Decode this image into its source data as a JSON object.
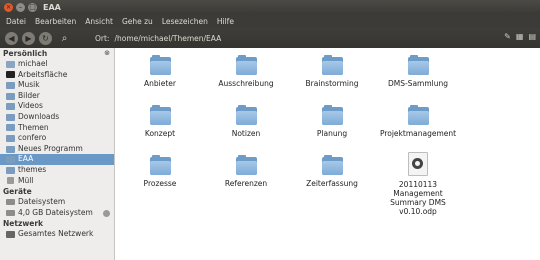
{
  "window": {
    "title": "EAA",
    "close_glyph": "×",
    "minimize_glyph": "–",
    "maximize_glyph": "□"
  },
  "menu": [
    "Datei",
    "Bearbeiten",
    "Ansicht",
    "Gehe zu",
    "Lesezeichen",
    "Hilfe"
  ],
  "toolbar": {
    "back_icon": "back-arrow-icon",
    "forward_icon": "forward-arrow-icon",
    "reload_icon": "reload-icon",
    "search_icon": "search-icon",
    "search_glyph": "⌕",
    "location_label": "Ort:",
    "location_path": "/home/michael/Themen/EAA",
    "view_icons": [
      "edit-path-icon",
      "icon-view-icon",
      "list-view-icon"
    ],
    "view_glyphs": [
      "✎",
      "▦",
      "▤"
    ]
  },
  "sidebar": {
    "personal_title": "Persönlich",
    "close_glyph": "⊗",
    "personal": [
      {
        "label": "michael",
        "icon": "home-icon"
      },
      {
        "label": "Arbeitsfläche",
        "icon": "desktop-icon"
      },
      {
        "label": "Musik",
        "icon": "folder-icon"
      },
      {
        "label": "Bilder",
        "icon": "folder-icon"
      },
      {
        "label": "Videos",
        "icon": "folder-icon"
      },
      {
        "label": "Downloads",
        "icon": "folder-icon"
      },
      {
        "label": "Themen",
        "icon": "folder-icon"
      },
      {
        "label": "confero",
        "icon": "folder-icon"
      },
      {
        "label": "Neues Programm",
        "icon": "folder-icon"
      },
      {
        "label": "EAA",
        "icon": "folder-icon",
        "selected": true
      },
      {
        "label": "themes",
        "icon": "folder-icon"
      },
      {
        "label": "Müll",
        "icon": "trash-icon"
      }
    ],
    "devices_title": "Geräte",
    "devices": [
      {
        "label": "Dateisystem",
        "icon": "drive-icon"
      },
      {
        "label": "4,0 GB Dateisystem",
        "icon": "drive-icon",
        "eject": true
      }
    ],
    "network_title": "Netzwerk",
    "network": [
      {
        "label": "Gesamtes Netzwerk",
        "icon": "network-icon"
      }
    ]
  },
  "files": [
    {
      "label": "Anbieter",
      "type": "folder"
    },
    {
      "label": "Ausschreibung",
      "type": "folder"
    },
    {
      "label": "Brainstorming",
      "type": "folder"
    },
    {
      "label": "DMS-Sammlung",
      "type": "folder"
    },
    {
      "label": "Konzept",
      "type": "folder"
    },
    {
      "label": "Notizen",
      "type": "folder"
    },
    {
      "label": "Planung",
      "type": "folder"
    },
    {
      "label": "Projektmanagement",
      "type": "folder"
    },
    {
      "label": "Prozesse",
      "type": "folder"
    },
    {
      "label": "Referenzen",
      "type": "folder"
    },
    {
      "label": "Zeiterfassung",
      "type": "folder"
    },
    {
      "label": "20110113 Management Summary DMS v0.10.odp",
      "type": "document"
    }
  ],
  "colors": {
    "selection": "#6b99c7",
    "folder": "#7eabd7",
    "close_button": "#e05a2a",
    "chrome": "#3c3b37"
  }
}
